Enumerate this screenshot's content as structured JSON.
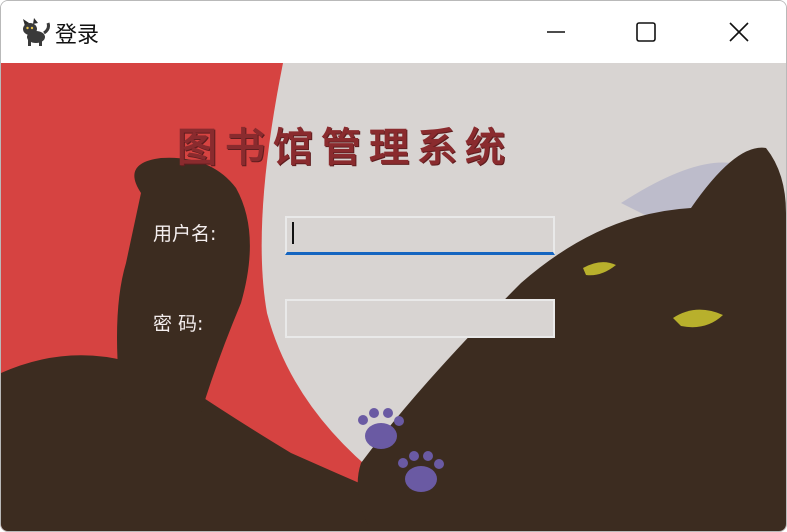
{
  "window": {
    "title": "登录",
    "controls": {
      "minimize": "minimize-icon",
      "maximize": "maximize-icon",
      "close": "close-icon"
    }
  },
  "login": {
    "heading": "图书馆管理系统",
    "username_label": "用户名:",
    "username_value": "",
    "password_label": "密   码:",
    "password_value": ""
  },
  "colors": {
    "heading": "#8a2b2e",
    "focus_underline": "#1565c0",
    "background_red": "#d64341",
    "background_cream": "#d8d4d2",
    "cat_brown": "#3c2c20",
    "cat_eye": "#b8b02c",
    "paw_purple": "#6a5aa3"
  }
}
